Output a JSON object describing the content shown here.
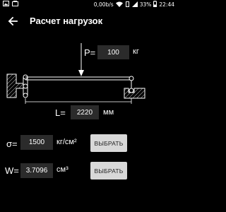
{
  "status_bar": {
    "data_rate": "0,00b/s",
    "battery": "33%",
    "time": "22:44"
  },
  "app_bar": {
    "title": "Расчет нагрузок"
  },
  "load": {
    "label": "P=",
    "value": "100",
    "unit": "кг"
  },
  "length": {
    "label": "L=",
    "value": "2220",
    "unit": "мм"
  },
  "stress": {
    "label": "σ=",
    "value": "1500",
    "unit": "кг/см²",
    "button": "ВЫБРАТЬ"
  },
  "section_modulus": {
    "label": "W=",
    "value": "3.7096",
    "unit": "см³",
    "button": "ВЫБРАТЬ"
  },
  "colors": {
    "background": "#000000",
    "field": "#2b2b2b",
    "button": "#d8d8d8",
    "line": "#ffffff"
  }
}
